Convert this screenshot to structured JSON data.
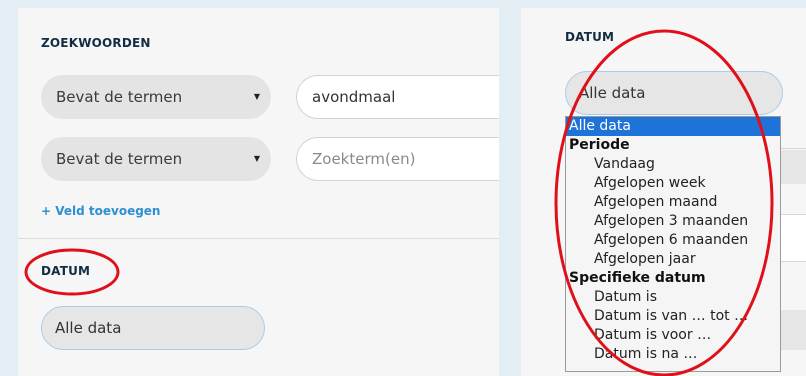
{
  "left_panel": {
    "keywords_title": "ZOEKWOORDEN",
    "rows": [
      {
        "operator": "Bevat de termen",
        "value": "avondmaal",
        "placeholder": ""
      },
      {
        "operator": "Bevat de termen",
        "value": "",
        "placeholder": "Zoekterm(en)"
      }
    ],
    "add_field": "+ Veld toevoegen",
    "date_title": "DATUM",
    "date_value": "Alle data"
  },
  "right_panel": {
    "date_title": "DATUM",
    "date_value": "Alle data",
    "dropdown_options": [
      {
        "label": "Alle data",
        "kind": "selected"
      },
      {
        "label": "Periode",
        "kind": "group"
      },
      {
        "label": "Vandaag",
        "kind": "sub"
      },
      {
        "label": "Afgelopen week",
        "kind": "sub"
      },
      {
        "label": "Afgelopen maand",
        "kind": "sub"
      },
      {
        "label": "Afgelopen 3 maanden",
        "kind": "sub"
      },
      {
        "label": "Afgelopen 6 maanden",
        "kind": "sub"
      },
      {
        "label": "Afgelopen jaar",
        "kind": "sub"
      },
      {
        "label": "Specifieke datum",
        "kind": "group"
      },
      {
        "label": "Datum is",
        "kind": "sub"
      },
      {
        "label": "Datum is van … tot …",
        "kind": "sub"
      },
      {
        "label": "Datum is voor …",
        "kind": "sub"
      },
      {
        "label": "Datum is na …",
        "kind": "sub"
      }
    ]
  },
  "colors": {
    "annotation": "#e0101b",
    "selected": "#1e73d8",
    "link": "#2e8fd1",
    "heading": "#122c43"
  },
  "icons": {
    "select_caret": "triangle-down"
  }
}
